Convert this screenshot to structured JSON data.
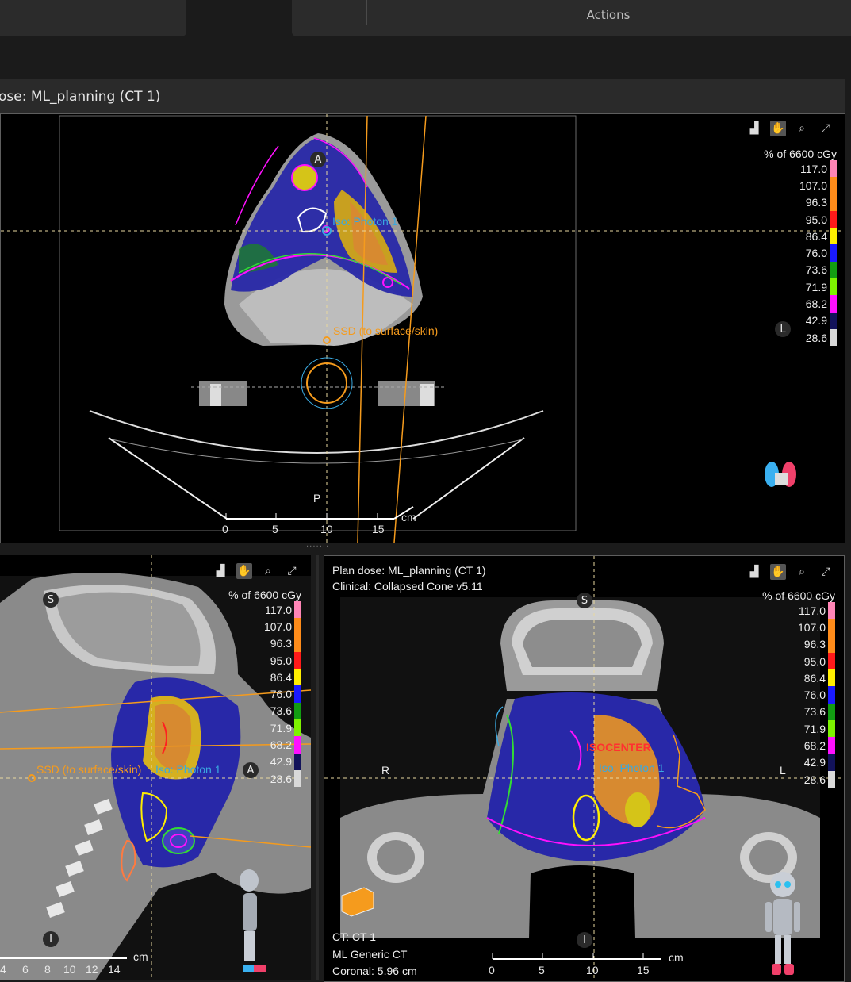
{
  "header": {
    "actions_label": "Actions"
  },
  "axial_view": {
    "title": "ose: ML_planning (CT 1)",
    "iso_label": "Iso: Photon 1",
    "ssd_label": "SSD (to surface/skin)",
    "orient_a": "A",
    "orient_p": "P",
    "orient_l": "L",
    "scale": {
      "ticks": [
        "0",
        "5",
        "10",
        "15"
      ],
      "unit": "cm"
    }
  },
  "sagittal_view": {
    "iso_label": "Iso: Photon 1",
    "ssd_label": "SSD (to surface/skin)",
    "orient_s": "S",
    "orient_a": "A",
    "orient_i": "I",
    "scale": {
      "ticks": [
        "4",
        "6",
        "8",
        "10",
        "12",
        "14"
      ],
      "unit": "cm"
    }
  },
  "coronal_view": {
    "title_line1": "Plan dose: ML_planning (CT 1)",
    "title_line2": "Clinical: Collapsed Cone v5.11",
    "iso_label": "Iso: Photon 1",
    "isocenter_label": "ISOCENTER",
    "orient_s": "S",
    "orient_r": "R",
    "orient_l": "L",
    "orient_i": "I",
    "info_line1": "CT: CT 1",
    "info_line2": "ML Generic CT",
    "info_line3": "Coronal: 5.96 cm",
    "scale": {
      "ticks": [
        "0",
        "5",
        "10",
        "15"
      ],
      "unit": "cm"
    }
  },
  "legend": {
    "unit": "% of 6600 cGy",
    "levels": [
      {
        "value": "117.0",
        "color": "#ff85b6"
      },
      {
        "value": "107.0",
        "color": "#ff8c1a"
      },
      {
        "value": "96.3",
        "color": "#ff8c1a"
      },
      {
        "value": "95.0",
        "color": "#ff1a1a"
      },
      {
        "value": "86.4",
        "color": "#ffee00"
      },
      {
        "value": "76.0",
        "color": "#1a1aff"
      },
      {
        "value": "73.6",
        "color": "#129c12"
      },
      {
        "value": "71.9",
        "color": "#7df200"
      },
      {
        "value": "68.2",
        "color": "#ff10ff"
      },
      {
        "value": "42.9",
        "color": "#12125a"
      },
      {
        "value": "28.6",
        "color": "#d9d9d9"
      }
    ]
  },
  "icons": [
    "histogram-icon",
    "pan-hand-icon",
    "zoom-icon",
    "fullscreen-icon"
  ]
}
